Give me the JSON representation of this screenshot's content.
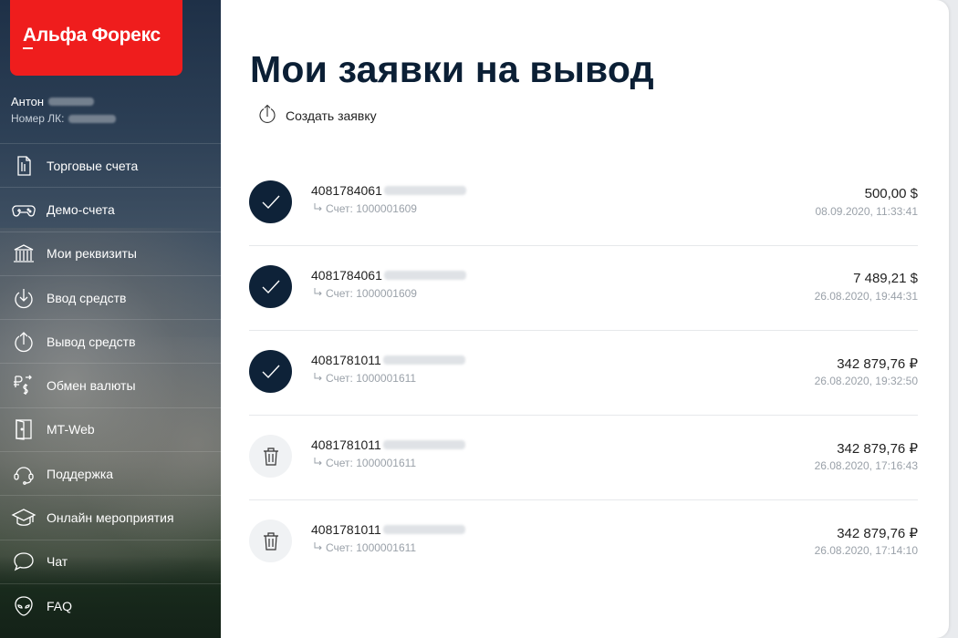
{
  "brand": {
    "logo_text": "Альфа Форекс",
    "accent_color": "#ef1d1d",
    "dark_color": "#0e2238"
  },
  "user": {
    "name": "Антон",
    "lk_label": "Номер ЛК:"
  },
  "sidebar": {
    "items": [
      {
        "label": "Торговые счета",
        "icon": "document-icon"
      },
      {
        "label": "Демо-счета",
        "icon": "gamepad-icon"
      },
      {
        "label": "Мои реквизиты",
        "icon": "bank-icon"
      },
      {
        "label": "Ввод средств",
        "icon": "arrow-down-circle-icon"
      },
      {
        "label": "Вывод средств",
        "icon": "arrow-up-circle-icon"
      },
      {
        "label": "Обмен валюты",
        "icon": "currency-exchange-icon"
      },
      {
        "label": "MT-Web",
        "icon": "door-icon"
      },
      {
        "label": "Поддержка",
        "icon": "headset-icon"
      },
      {
        "label": "Онлайн мероприятия",
        "icon": "graduation-cap-icon"
      },
      {
        "label": "Чат",
        "icon": "chat-bubble-icon"
      },
      {
        "label": "FAQ",
        "icon": "alien-head-icon"
      }
    ]
  },
  "main": {
    "title": "Мои заявки на вывод",
    "create_label": "Создать заявку",
    "requests": [
      {
        "account": "4081784061",
        "sub": "Счет: 1000001609",
        "amount": "500,00 $",
        "date": "08.09.2020, 11:33:41",
        "status": "done"
      },
      {
        "account": "4081784061",
        "sub": "Счет: 1000001609",
        "amount": "7 489,21 $",
        "date": "26.08.2020, 19:44:31",
        "status": "done"
      },
      {
        "account": "4081781011",
        "sub": "Счет: 1000001611",
        "amount": "342 879,76 ₽",
        "date": "26.08.2020, 19:32:50",
        "status": "done"
      },
      {
        "account": "4081781011",
        "sub": "Счет: 1000001611",
        "amount": "342 879,76 ₽",
        "date": "26.08.2020, 17:16:43",
        "status": "cancelled"
      },
      {
        "account": "4081781011",
        "sub": "Счет: 1000001611",
        "amount": "342 879,76 ₽",
        "date": "26.08.2020, 17:14:10",
        "status": "cancelled"
      }
    ]
  }
}
